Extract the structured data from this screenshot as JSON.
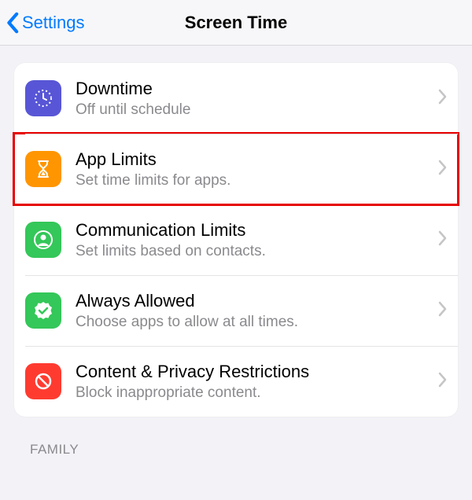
{
  "nav": {
    "back_label": "Settings",
    "title": "Screen Time"
  },
  "rows": {
    "downtime": {
      "title": "Downtime",
      "subtitle": "Off until schedule",
      "icon_color": "#5856d6"
    },
    "app_limits": {
      "title": "App Limits",
      "subtitle": "Set time limits for apps.",
      "icon_color": "#ff9500",
      "highlighted": true
    },
    "communication": {
      "title": "Communication Limits",
      "subtitle": "Set limits based on contacts.",
      "icon_color": "#34c759"
    },
    "always_allowed": {
      "title": "Always Allowed",
      "subtitle": "Choose apps to allow at all times.",
      "icon_color": "#34c759"
    },
    "restrictions": {
      "title": "Content & Privacy Restrictions",
      "subtitle": "Block inappropriate content.",
      "icon_color": "#ff3b30"
    }
  },
  "sections": {
    "family": "FAMILY"
  }
}
